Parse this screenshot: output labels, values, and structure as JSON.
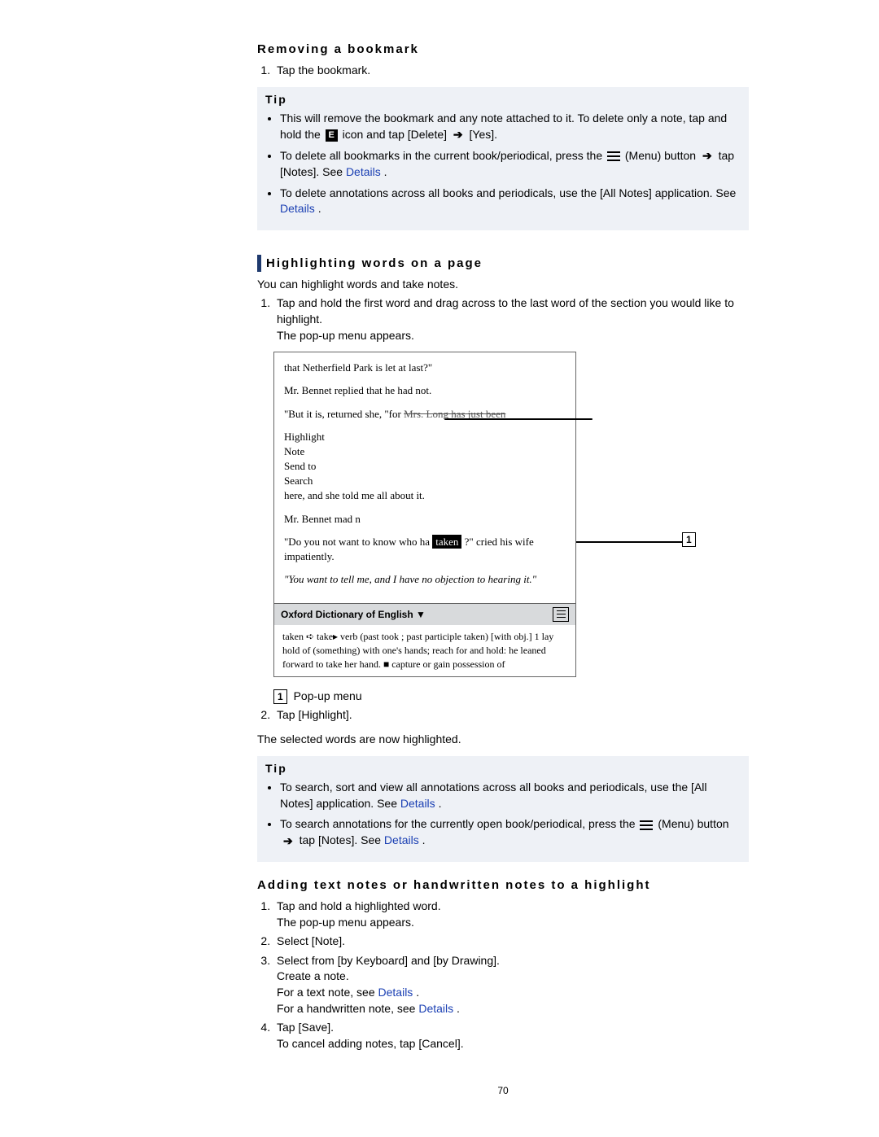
{
  "page_number": "70",
  "section1": {
    "title": "Removing a bookmark",
    "step1": "Tap the bookmark.",
    "tip_label": "Tip",
    "tip_items": {
      "t1a": "This will remove the bookmark and any note attached to it. To delete only a note, tap and hold the ",
      "t1b": " icon and tap [Delete] ",
      "t1c": " [Yes].",
      "t2a": "To delete all bookmarks in the current book/periodical, press the ",
      "t2b": " (Menu) button ",
      "t2c": " tap [Notes]. See ",
      "t2d": "Details",
      "t2e": ".",
      "t3a": "To delete annotations across all books and periodicals, use the [All Notes] application. See ",
      "t3b": "Details",
      "t3c": "."
    }
  },
  "section2": {
    "title": "Highlighting words on a page",
    "intro": "You can highlight words and take notes.",
    "step1a": "Tap and hold the first word and drag across to the last word of the section you would like to highlight.",
    "step1b": "The pop-up menu appears.",
    "callout_num": "1",
    "callout_label": "Pop-up menu",
    "step2": "Tap [Highlight].",
    "after": "The selected words are now highlighted.",
    "tip_label": "Tip",
    "tip_items": {
      "t1a": "To search, sort and view all annotations across all books and periodicals, use the [All Notes] application. See ",
      "t1b": "Details",
      "t1c": ".",
      "t2a": "To search annotations for the currently open book/periodical, press the ",
      "t2b": " (Menu) button ",
      "t2c": " tap [Notes]. See ",
      "t2d": "Details",
      "t2e": "."
    }
  },
  "screenshot": {
    "line1": "that Netherfield Park is let at last?\"",
    "line2": "Mr. Bennet replied that he had not.",
    "line3a": "\"But it is, returned she, \"for ",
    "line3over": "Mrs. Long has just been",
    "line3b": " here, and she told me all about it.",
    "popup_highlight": "Highlight",
    "popup_note": "Note",
    "popup_send": "Send to",
    "popup_search": "Search",
    "line4a": "Mr. Bennet mad  n",
    "line5a": "\"Do you not want to know who ha",
    "line5tak": "taken",
    "line5b": "?\" cried his wife impatiently.",
    "line6": "\"You want to tell me, and I have no objection to hearing it.\"",
    "dict_title": "Oxford Dictionary of English  ▼",
    "dict_def": "taken ➪ take▸ verb (past took ; past participle taken) [with obj.] 1 lay hold of (something) with one's hands; reach for and hold: he leaned forward to take her hand.   ■ capture or gain possession of"
  },
  "section3": {
    "title": "Adding text notes or handwritten notes to a highlight",
    "s1a": "Tap and hold a highlighted word.",
    "s1b": "The pop-up menu appears.",
    "s2": "Select [Note].",
    "s3a": "Select from [by Keyboard] and [by Drawing].",
    "s3b": "Create a note.",
    "s3c": "For a text note, see ",
    "s3c_link": "Details",
    "s3d": ".",
    "s3e": "For a handwritten note, see ",
    "s3e_link": "Details",
    "s3f": ".",
    "s4a": "Tap [Save].",
    "s4b": "To cancel adding notes, tap [Cancel]."
  },
  "icons": {
    "note_icon_text": "E",
    "arrow": "➔"
  }
}
